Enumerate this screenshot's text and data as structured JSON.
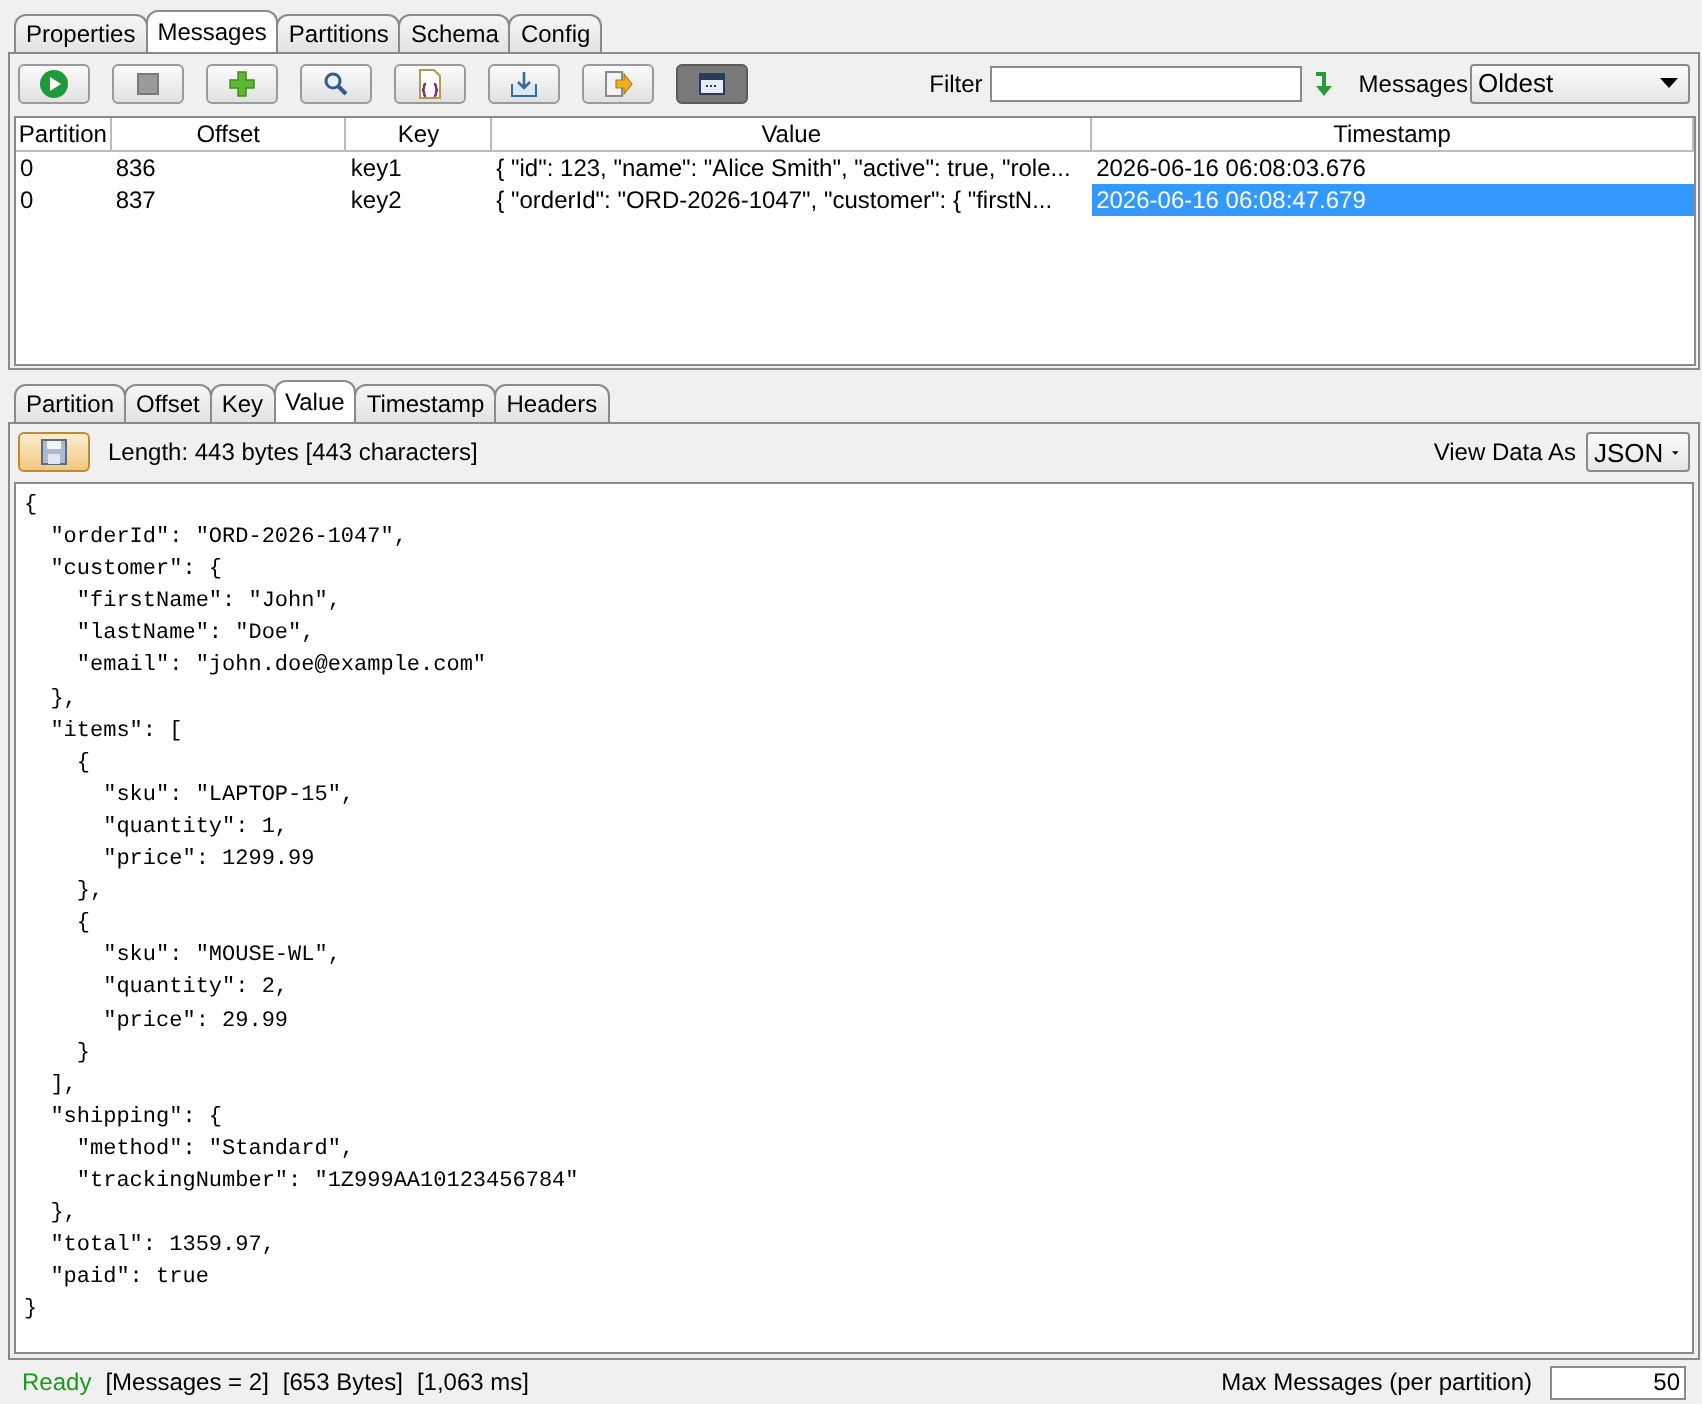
{
  "top_tabs": [
    {
      "label": "Properties",
      "selected": false
    },
    {
      "label": "Messages",
      "selected": true
    },
    {
      "label": "Partitions",
      "selected": false
    },
    {
      "label": "Schema",
      "selected": false
    },
    {
      "label": "Config",
      "selected": false
    }
  ],
  "toolbar": [
    {
      "pressed": false
    },
    {
      "pressed": false
    },
    {
      "pressed": false
    },
    {
      "pressed": false
    },
    {
      "pressed": false
    },
    {
      "pressed": false
    },
    {
      "pressed": false
    },
    {
      "pressed": true
    }
  ],
  "filter": {
    "label": "Filter"
  },
  "messages_select": {
    "label": "Messages",
    "value": "Oldest"
  },
  "table": {
    "columns": [
      "Partition",
      "Offset",
      "Key",
      "Value",
      "Timestamp"
    ],
    "rows": [
      {
        "cells": [
          "0",
          "836",
          "key1",
          "{  \"id\": 123,  \"name\": \"Alice Smith\",  \"active\": true,  \"role...",
          "2026-06-16 06:08:03.676"
        ],
        "selected": false
      },
      {
        "cells": [
          "0",
          "837",
          "key2",
          "{  \"orderId\": \"ORD-2026-1047\",  \"customer\": {    \"firstN...",
          "2026-06-16 06:08:47.679"
        ],
        "selected": true
      }
    ]
  },
  "detail_tabs": [
    {
      "label": "Partition",
      "selected": false
    },
    {
      "label": "Offset",
      "selected": false
    },
    {
      "label": "Key",
      "selected": false
    },
    {
      "label": "Value",
      "selected": true
    },
    {
      "label": "Timestamp",
      "selected": false
    },
    {
      "label": "Headers",
      "selected": false
    }
  ],
  "length_info": "Length: 443 bytes [443 characters]",
  "view_as": {
    "label": "View Data As",
    "value": "JSON"
  },
  "value_lines": [
    "{",
    "  \"orderId\": \"ORD-2026-1047\",",
    "  \"customer\": {",
    "    \"firstName\": \"John\",",
    "    \"lastName\": \"Doe\",",
    "    \"email\": \"john.doe@example.com\"",
    "  },",
    "  \"items\": [",
    "    {",
    "      \"sku\": \"LAPTOP-15\",",
    "      \"quantity\": 1,",
    "      \"price\": 1299.99",
    "    },",
    "    {",
    "      \"sku\": \"MOUSE-WL\",",
    "      \"quantity\": 2,",
    "      \"price\": 29.99",
    "    }",
    "  ],",
    "  \"shipping\": {",
    "    \"method\": \"Standard\",",
    "    \"trackingNumber\": \"1Z999AA10123456784\"",
    "  },",
    "  \"total\": 1359.97,",
    "  \"paid\": true",
    "}"
  ],
  "status_bar": {
    "state": "Ready",
    "messages": "[Messages = 2]",
    "bytes": "[653 Bytes]",
    "time": "[1,063 ms]",
    "max_label": "Max Messages (per partition)",
    "max_value": "50"
  }
}
